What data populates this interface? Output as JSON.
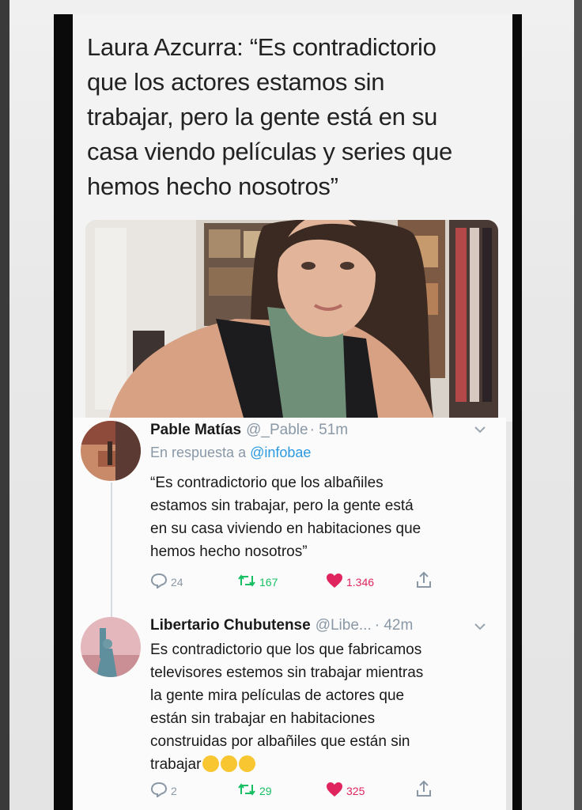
{
  "headline": {
    "lines": [
      "Laura Azcurra: “Es contradictorio",
      "que los actores estamos sin",
      "trabajar, pero la gente está en su",
      "casa viendo películas y series que",
      "hemos hecho nosotros”"
    ]
  },
  "tweets": [
    {
      "name": "Pable Matías",
      "handle": "@_Pable",
      "time": "· 51m",
      "reply_prefix": "En respuesta a",
      "reply_mention": "@infobae",
      "body_lines": [
        "“Es contradictorio que los albañiles",
        "estamos sin trabajar, pero la gente está",
        "en su casa viviendo en habitaciones que",
        "hemos hecho nosotros”"
      ],
      "replies": "24",
      "retweets": "167",
      "likes": "1.346"
    },
    {
      "name": "Libertario Chubutense",
      "handle": "@Libe...",
      "time": "· 42m",
      "body_lines": [
        "Es contradictorio que los que fabricamos",
        "televisores estemos sin trabajar mientras",
        "la gente mira películas de actores que",
        "están sin trabajar en habitaciones",
        "construidas por albañiles que están sin",
        "trabajar"
      ],
      "replies": "2",
      "retweets": "29",
      "likes": "325"
    }
  ],
  "colors": {
    "link": "#2b9ae0",
    "retweet": "#17bf63",
    "like": "#e0245e",
    "muted": "#8a98a6"
  },
  "icons": [
    "reply-icon",
    "retweet-icon",
    "heart-icon",
    "share-icon",
    "chevron-down-icon",
    "laughing-emoji-icon"
  ]
}
